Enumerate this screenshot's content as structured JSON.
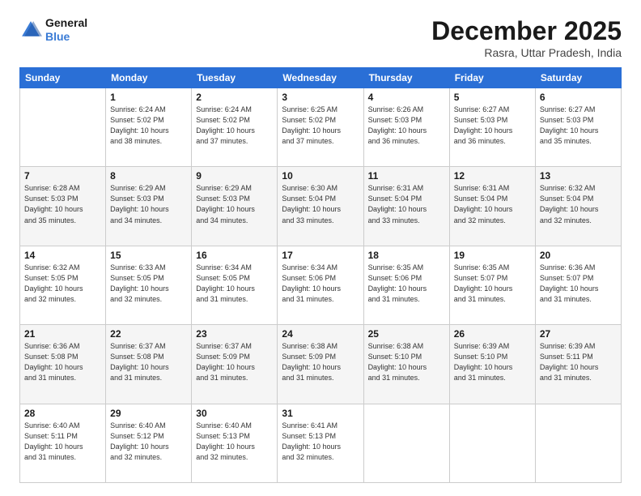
{
  "logo": {
    "line1": "General",
    "line2": "Blue"
  },
  "title": "December 2025",
  "location": "Rasra, Uttar Pradesh, India",
  "weekdays": [
    "Sunday",
    "Monday",
    "Tuesday",
    "Wednesday",
    "Thursday",
    "Friday",
    "Saturday"
  ],
  "weeks": [
    [
      {
        "day": "",
        "info": ""
      },
      {
        "day": "1",
        "info": "Sunrise: 6:24 AM\nSunset: 5:02 PM\nDaylight: 10 hours\nand 38 minutes."
      },
      {
        "day": "2",
        "info": "Sunrise: 6:24 AM\nSunset: 5:02 PM\nDaylight: 10 hours\nand 37 minutes."
      },
      {
        "day": "3",
        "info": "Sunrise: 6:25 AM\nSunset: 5:02 PM\nDaylight: 10 hours\nand 37 minutes."
      },
      {
        "day": "4",
        "info": "Sunrise: 6:26 AM\nSunset: 5:03 PM\nDaylight: 10 hours\nand 36 minutes."
      },
      {
        "day": "5",
        "info": "Sunrise: 6:27 AM\nSunset: 5:03 PM\nDaylight: 10 hours\nand 36 minutes."
      },
      {
        "day": "6",
        "info": "Sunrise: 6:27 AM\nSunset: 5:03 PM\nDaylight: 10 hours\nand 35 minutes."
      }
    ],
    [
      {
        "day": "7",
        "info": "Sunrise: 6:28 AM\nSunset: 5:03 PM\nDaylight: 10 hours\nand 35 minutes."
      },
      {
        "day": "8",
        "info": "Sunrise: 6:29 AM\nSunset: 5:03 PM\nDaylight: 10 hours\nand 34 minutes."
      },
      {
        "day": "9",
        "info": "Sunrise: 6:29 AM\nSunset: 5:03 PM\nDaylight: 10 hours\nand 34 minutes."
      },
      {
        "day": "10",
        "info": "Sunrise: 6:30 AM\nSunset: 5:04 PM\nDaylight: 10 hours\nand 33 minutes."
      },
      {
        "day": "11",
        "info": "Sunrise: 6:31 AM\nSunset: 5:04 PM\nDaylight: 10 hours\nand 33 minutes."
      },
      {
        "day": "12",
        "info": "Sunrise: 6:31 AM\nSunset: 5:04 PM\nDaylight: 10 hours\nand 32 minutes."
      },
      {
        "day": "13",
        "info": "Sunrise: 6:32 AM\nSunset: 5:04 PM\nDaylight: 10 hours\nand 32 minutes."
      }
    ],
    [
      {
        "day": "14",
        "info": "Sunrise: 6:32 AM\nSunset: 5:05 PM\nDaylight: 10 hours\nand 32 minutes."
      },
      {
        "day": "15",
        "info": "Sunrise: 6:33 AM\nSunset: 5:05 PM\nDaylight: 10 hours\nand 32 minutes."
      },
      {
        "day": "16",
        "info": "Sunrise: 6:34 AM\nSunset: 5:05 PM\nDaylight: 10 hours\nand 31 minutes."
      },
      {
        "day": "17",
        "info": "Sunrise: 6:34 AM\nSunset: 5:06 PM\nDaylight: 10 hours\nand 31 minutes."
      },
      {
        "day": "18",
        "info": "Sunrise: 6:35 AM\nSunset: 5:06 PM\nDaylight: 10 hours\nand 31 minutes."
      },
      {
        "day": "19",
        "info": "Sunrise: 6:35 AM\nSunset: 5:07 PM\nDaylight: 10 hours\nand 31 minutes."
      },
      {
        "day": "20",
        "info": "Sunrise: 6:36 AM\nSunset: 5:07 PM\nDaylight: 10 hours\nand 31 minutes."
      }
    ],
    [
      {
        "day": "21",
        "info": "Sunrise: 6:36 AM\nSunset: 5:08 PM\nDaylight: 10 hours\nand 31 minutes."
      },
      {
        "day": "22",
        "info": "Sunrise: 6:37 AM\nSunset: 5:08 PM\nDaylight: 10 hours\nand 31 minutes."
      },
      {
        "day": "23",
        "info": "Sunrise: 6:37 AM\nSunset: 5:09 PM\nDaylight: 10 hours\nand 31 minutes."
      },
      {
        "day": "24",
        "info": "Sunrise: 6:38 AM\nSunset: 5:09 PM\nDaylight: 10 hours\nand 31 minutes."
      },
      {
        "day": "25",
        "info": "Sunrise: 6:38 AM\nSunset: 5:10 PM\nDaylight: 10 hours\nand 31 minutes."
      },
      {
        "day": "26",
        "info": "Sunrise: 6:39 AM\nSunset: 5:10 PM\nDaylight: 10 hours\nand 31 minutes."
      },
      {
        "day": "27",
        "info": "Sunrise: 6:39 AM\nSunset: 5:11 PM\nDaylight: 10 hours\nand 31 minutes."
      }
    ],
    [
      {
        "day": "28",
        "info": "Sunrise: 6:40 AM\nSunset: 5:11 PM\nDaylight: 10 hours\nand 31 minutes."
      },
      {
        "day": "29",
        "info": "Sunrise: 6:40 AM\nSunset: 5:12 PM\nDaylight: 10 hours\nand 32 minutes."
      },
      {
        "day": "30",
        "info": "Sunrise: 6:40 AM\nSunset: 5:13 PM\nDaylight: 10 hours\nand 32 minutes."
      },
      {
        "day": "31",
        "info": "Sunrise: 6:41 AM\nSunset: 5:13 PM\nDaylight: 10 hours\nand 32 minutes."
      },
      {
        "day": "",
        "info": ""
      },
      {
        "day": "",
        "info": ""
      },
      {
        "day": "",
        "info": ""
      }
    ]
  ]
}
